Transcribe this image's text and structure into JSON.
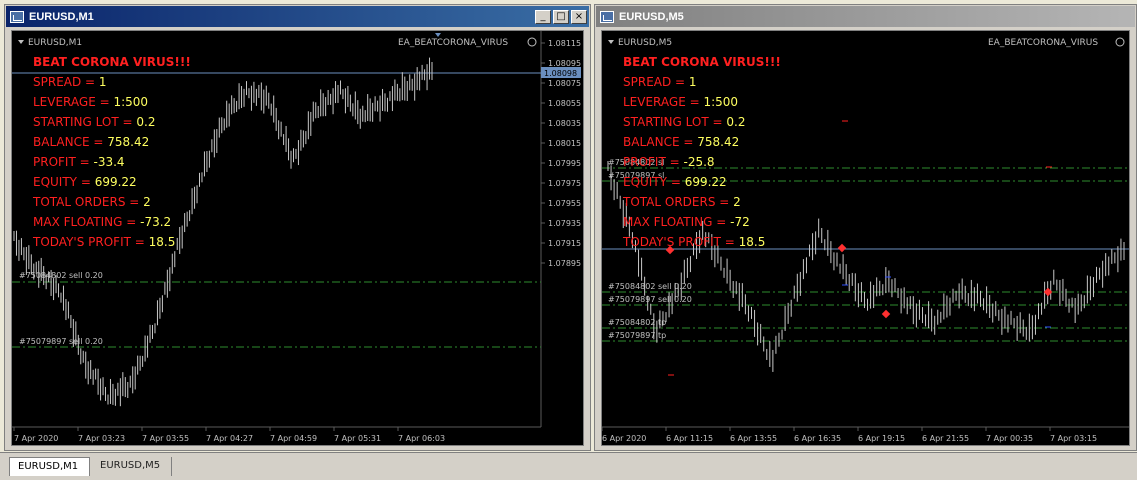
{
  "tabs": [
    {
      "label": "EURUSD,M1"
    },
    {
      "label": "EURUSD,M5"
    }
  ],
  "colors": {
    "text_red": "#ff2020",
    "value_yellow": "#ffff60",
    "grid": "#5a5a5a",
    "order_line": "#2e8b2e",
    "price_line": "#6b8fbf",
    "candle": "#c8c8c8",
    "label": "#c0c0c0"
  },
  "win_m1": {
    "title": "EURUSD,M1",
    "symbol": "EURUSD,M1",
    "ea": "EA_BEATCORONA_VIRUS",
    "price_tag": "1.08098",
    "price_scale": [
      "1.08115",
      "1.08095",
      "1.08075",
      "1.08055",
      "1.08035",
      "1.08015",
      "1.07995",
      "1.07975",
      "1.07955",
      "1.07935",
      "1.07915",
      "1.07895"
    ],
    "time_scale": [
      "7 Apr 2020",
      "7 Apr 03:23",
      "7 Apr 03:55",
      "7 Apr 04:27",
      "7 Apr 04:59",
      "7 Apr 05:31",
      "7 Apr 06:03"
    ],
    "info": {
      "heading": "BEAT CORONA VIRUS!!!",
      "rows": [
        {
          "label": "SPREAD = ",
          "value": "1"
        },
        {
          "label": "LEVERAGE = ",
          "value": "1:500"
        },
        {
          "label": "STARTING LOT = ",
          "value": "0.2"
        },
        {
          "label": "BALANCE = ",
          "value": "758.42"
        },
        {
          "label": "PROFIT = ",
          "value": "-33.4"
        },
        {
          "label": "EQUITY = ",
          "value": "699.22"
        },
        {
          "label": "TOTAL ORDERS = ",
          "value": "2"
        },
        {
          "label": "MAX FLOATING = ",
          "value": "-73.2"
        },
        {
          "label": "TODAY'S PROFIT = ",
          "value": "18.5"
        }
      ]
    },
    "order_labels": [
      "#75084802 sell 0.20",
      "#75079897 sell 0.20"
    ]
  },
  "win_m5": {
    "title": "EURUSD,M5",
    "symbol": "EURUSD,M5",
    "ea": "EA_BEATCORONA_VIRUS",
    "time_scale": [
      "6 Apr 2020",
      "6 Apr 11:15",
      "6 Apr 13:55",
      "6 Apr 16:35",
      "6 Apr 19:15",
      "6 Apr 21:55",
      "7 Apr 00:35",
      "7 Apr 03:15"
    ],
    "info": {
      "heading": "BEAT CORONA VIRUS!!!",
      "rows": [
        {
          "label": "SPREAD = ",
          "value": "1"
        },
        {
          "label": "LEVERAGE = ",
          "value": "1:500"
        },
        {
          "label": "STARTING LOT = ",
          "value": "0.2"
        },
        {
          "label": "BALANCE = ",
          "value": "758.42"
        },
        {
          "label": "PROFIT = ",
          "value": "-25.8"
        },
        {
          "label": "EQUITY = ",
          "value": "699.22"
        },
        {
          "label": "TOTAL ORDERS = ",
          "value": "2"
        },
        {
          "label": "MAX FLOATING = ",
          "value": "-72"
        },
        {
          "label": "TODAY'S PROFIT = ",
          "value": "18.5"
        }
      ]
    },
    "order_labels": [
      "#75084802 sl",
      "#75079897 sl",
      "#75084802 sell 0.20",
      "#75079897 sell 0.20",
      "#75084802 tp",
      "#75079897 tp"
    ]
  }
}
